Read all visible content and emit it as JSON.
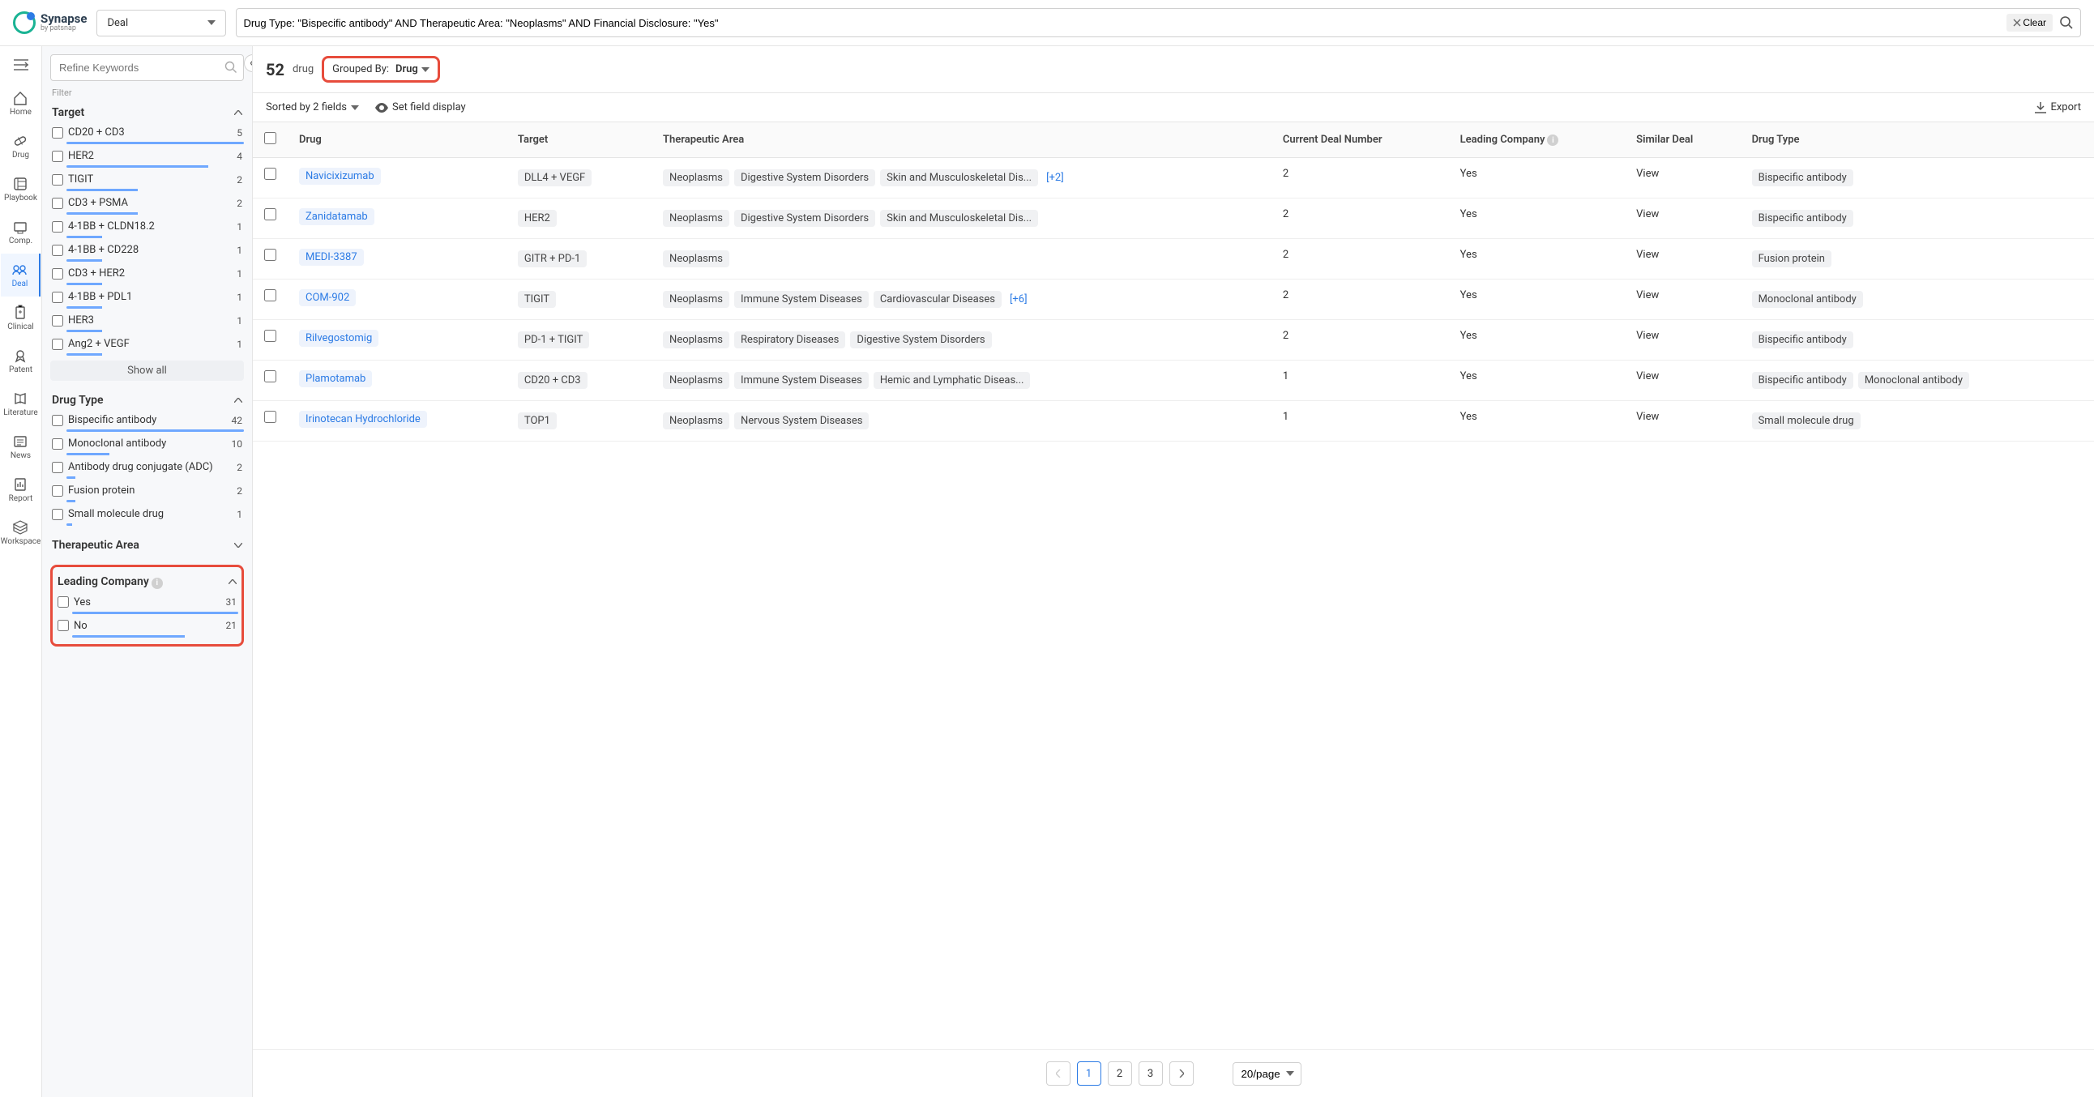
{
  "brand": {
    "name": "Synapse",
    "sub": "by patsnap"
  },
  "module_select": "Deal",
  "search_query": "Drug Type: \"Bispecific antibody\" AND Therapeutic Area: \"Neoplasms\" AND Financial Disclosure: \"Yes\"",
  "clear_label": "Clear",
  "vnav": [
    {
      "id": "home",
      "label": "Home"
    },
    {
      "id": "drug",
      "label": "Drug"
    },
    {
      "id": "playbook",
      "label": "Playbook"
    },
    {
      "id": "comp",
      "label": "Comp."
    },
    {
      "id": "deal",
      "label": "Deal",
      "active": true
    },
    {
      "id": "clinical",
      "label": "Clinical"
    },
    {
      "id": "patent",
      "label": "Patent"
    },
    {
      "id": "literature",
      "label": "Literature"
    },
    {
      "id": "news",
      "label": "News"
    },
    {
      "id": "report",
      "label": "Report"
    },
    {
      "id": "workspace",
      "label": "Workspace"
    }
  ],
  "refine_placeholder": "Refine Keywords",
  "filter_label": "Filter",
  "show_all": "Show all",
  "filters": {
    "target": {
      "title": "Target",
      "items": [
        {
          "label": "CD20 + CD3",
          "count": 5,
          "pct": 100
        },
        {
          "label": "HER2",
          "count": 4,
          "pct": 80
        },
        {
          "label": "TIGIT",
          "count": 2,
          "pct": 40
        },
        {
          "label": "CD3 + PSMA",
          "count": 2,
          "pct": 40
        },
        {
          "label": "4-1BB + CLDN18.2",
          "count": 1,
          "pct": 20
        },
        {
          "label": "4-1BB + CD228",
          "count": 1,
          "pct": 20
        },
        {
          "label": "CD3 + HER2",
          "count": 1,
          "pct": 20
        },
        {
          "label": "4-1BB + PDL1",
          "count": 1,
          "pct": 20
        },
        {
          "label": "HER3",
          "count": 1,
          "pct": 20
        },
        {
          "label": "Ang2 + VEGF",
          "count": 1,
          "pct": 20
        }
      ]
    },
    "drug_type": {
      "title": "Drug Type",
      "items": [
        {
          "label": "Bispecific antibody",
          "count": 42,
          "pct": 100
        },
        {
          "label": "Monoclonal antibody",
          "count": 10,
          "pct": 24
        },
        {
          "label": "Antibody drug conjugate (ADC)",
          "count": 2,
          "pct": 5
        },
        {
          "label": "Fusion protein",
          "count": 2,
          "pct": 5
        },
        {
          "label": "Small molecule drug",
          "count": 1,
          "pct": 3
        }
      ]
    },
    "therapeutic_area": {
      "title": "Therapeutic Area"
    },
    "leading_company": {
      "title": "Leading Company",
      "items": [
        {
          "label": "Yes",
          "count": 31,
          "pct": 100
        },
        {
          "label": "No",
          "count": 21,
          "pct": 68
        }
      ]
    }
  },
  "result_count": "52",
  "result_unit": "drug",
  "grouped_by_label": "Grouped By:",
  "grouped_by_value": "Drug",
  "sorted_label": "Sorted by 2 fields",
  "set_field_label": "Set field display",
  "export_label": "Export",
  "columns": {
    "drug": "Drug",
    "target": "Target",
    "ta": "Therapeutic Area",
    "deal_num": "Current Deal Number",
    "leading": "Leading Company",
    "similar": "Similar Deal",
    "drug_type": "Drug Type"
  },
  "view_label": "View",
  "rows": [
    {
      "drug": "Navicixizumab",
      "target": "DLL4 + VEGF",
      "ta": [
        "Neoplasms",
        "Digestive System Disorders",
        "Skin and Musculoskeletal Dis..."
      ],
      "ta_more": "[+2]",
      "deal_num": "2",
      "leading": "Yes",
      "types": [
        "Bispecific antibody"
      ]
    },
    {
      "drug": "Zanidatamab",
      "target": "HER2",
      "ta": [
        "Neoplasms",
        "Digestive System Disorders",
        "Skin and Musculoskeletal Dis..."
      ],
      "ta_more": "",
      "deal_num": "2",
      "leading": "Yes",
      "types": [
        "Bispecific antibody"
      ]
    },
    {
      "drug": "MEDI-3387",
      "target": "GITR + PD-1",
      "ta": [
        "Neoplasms"
      ],
      "ta_more": "",
      "deal_num": "2",
      "leading": "Yes",
      "types": [
        "Fusion protein"
      ]
    },
    {
      "drug": "COM-902",
      "target": "TIGIT",
      "ta": [
        "Neoplasms",
        "Immune System Diseases",
        "Cardiovascular Diseases"
      ],
      "ta_more": "[+6]",
      "deal_num": "2",
      "leading": "Yes",
      "types": [
        "Monoclonal antibody"
      ]
    },
    {
      "drug": "Rilvegostomig",
      "target": "PD-1 + TIGIT",
      "ta": [
        "Neoplasms",
        "Respiratory Diseases",
        "Digestive System Disorders"
      ],
      "ta_more": "",
      "deal_num": "2",
      "leading": "Yes",
      "types": [
        "Bispecific antibody"
      ]
    },
    {
      "drug": "Plamotamab",
      "target": "CD20 + CD3",
      "ta": [
        "Neoplasms",
        "Immune System Diseases",
        "Hemic and Lymphatic Diseas..."
      ],
      "ta_more": "",
      "deal_num": "1",
      "leading": "Yes",
      "types": [
        "Bispecific antibody",
        "Monoclonal antibody"
      ]
    },
    {
      "drug": "Irinotecan Hydrochloride",
      "target": "TOP1",
      "ta": [
        "Neoplasms",
        "Nervous System Diseases"
      ],
      "ta_more": "",
      "deal_num": "1",
      "leading": "Yes",
      "types": [
        "Small molecule drug"
      ]
    }
  ],
  "pagination": {
    "pages": [
      "1",
      "2",
      "3"
    ],
    "active": "1",
    "per_page": "20/page"
  }
}
